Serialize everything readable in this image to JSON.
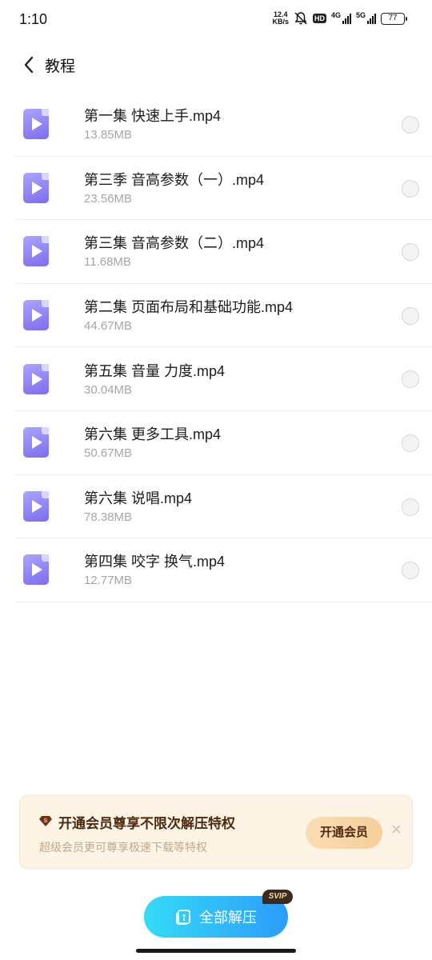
{
  "status_bar": {
    "time": "1:10",
    "net_speed_value": "12.4",
    "net_speed_unit": "KB/s",
    "hd_label": "HD",
    "signal1_label": "4G",
    "signal2_label": "5G",
    "battery": "77"
  },
  "header": {
    "title": "教程"
  },
  "files": [
    {
      "name": "第一集 快速上手.mp4",
      "size": "13.85MB"
    },
    {
      "name": "第三季 音高参数（一）.mp4",
      "size": "23.56MB"
    },
    {
      "name": "第三集 音高参数（二）.mp4",
      "size": "11.68MB"
    },
    {
      "name": "第二集 页面布局和基础功能.mp4",
      "size": "44.67MB"
    },
    {
      "name": "第五集 音量 力度.mp4",
      "size": "30.04MB"
    },
    {
      "name": "第六集 更多工具.mp4",
      "size": "50.67MB"
    },
    {
      "name": "第六集 说唱.mp4",
      "size": "78.38MB"
    },
    {
      "name": "第四集  咬字 换气.mp4",
      "size": "12.77MB"
    }
  ],
  "promo": {
    "title": "开通会员尊享不限次解压特权",
    "subtitle": "超级会员更可尊享极速下载等特权",
    "button_label": "开通会员",
    "close_glyph": "✕"
  },
  "action": {
    "extract_label": "全部解压",
    "badge": "SVIP"
  },
  "colors": {
    "accent_start": "#34dbf6",
    "accent_end": "#2c9dfa",
    "file_icon": "#8b7df5",
    "promo_bg": "#fdf4e6"
  }
}
